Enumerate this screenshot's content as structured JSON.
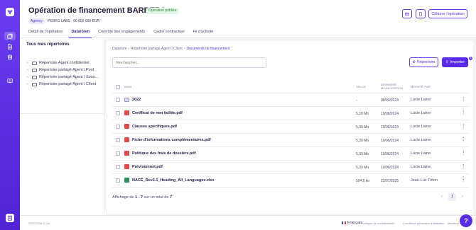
{
  "app": {
    "accent": "#5a2be8"
  },
  "rail": {
    "icons": [
      "logo-icon",
      "deals-icon",
      "documents-icon",
      "database-icon",
      "book-icon",
      "building-icon"
    ]
  },
  "header": {
    "title": "Opération de financement BARBERA",
    "status": "Opération publiée",
    "agency": "Agency",
    "subline": "PERKO LABS · 60 000 000 EUR",
    "close_label": "Clôturer l'opération"
  },
  "tabs": [
    "Détail de l'opération",
    "Dataroom",
    "Contrôle des engagements",
    "Cadre contractuel",
    "Fil d'activité"
  ],
  "tree": {
    "title": "Tous mes répertoires",
    "items": [
      "Répertoire Agent confidentiel",
      "Répertoire partagé Agent / Pool",
      "Répertoire partagé Agent / Sous...",
      "Répertoire partagé Agent / Client"
    ]
  },
  "breadcrumb": {
    "items": [
      "Datanom",
      "Répertoire partagé Agent / Client"
    ],
    "current": "Documents de financement"
  },
  "search": {
    "placeholder": "Rechercher..."
  },
  "actions": {
    "directory_label": "Répertoire",
    "import_label": "Importer",
    "import_count": "5"
  },
  "table": {
    "headers": {
      "name": "NOM",
      "size": "TAILLE",
      "date_line1": "DERNIÈRE",
      "date_line2": "MODIFICATION",
      "user": "MODIFIÉ PAR"
    },
    "rows": [
      {
        "type": "folder",
        "name": "2022",
        "size": "-",
        "date": "08/03/2024",
        "user": "Lucie Laine"
      },
      {
        "type": "pdf",
        "name": "Certificat de non faillite.pdf",
        "size": "5,39 Mo",
        "date": "10/06/2024",
        "user": "Lucie Laine"
      },
      {
        "type": "pdf",
        "name": "Clauses spécifiques.pdf",
        "size": "5,39 Mo",
        "date": "10/06/2024",
        "user": "Lucie Laine"
      },
      {
        "type": "pdf",
        "name": "Fiche d'informations complémentaires.pdf",
        "size": "5,39 Mo",
        "date": "10/06/2024",
        "user": "Lucie Laine"
      },
      {
        "type": "pdf",
        "name": "Politique des frais de dossiers.pdf",
        "size": "5,39 Mo",
        "date": "10/06/2024",
        "user": "Lucie Laine"
      },
      {
        "type": "pdf",
        "name": "Prévisionnel.pdf",
        "size": "5,39 Mo",
        "date": "10/06/2024",
        "user": "Lucie Laine"
      },
      {
        "type": "xlsx",
        "name": "NACE_Rev2.1_Heading_All_Languages.xlsx",
        "size": "504,5 ko",
        "date": "23/07/2025",
        "user": "Jean-Luc Triton"
      }
    ]
  },
  "pagination": {
    "prefix": "Affichage de",
    "range": "1 - 7",
    "middle": "sur un total de",
    "total": "7",
    "page": "1"
  },
  "footer": {
    "copyright": "2020-2025 © Ca",
    "language": "Français",
    "links": [
      "Politique de confidentialité",
      "Conditions générales d'utilisation",
      "Mentions l"
    ]
  }
}
